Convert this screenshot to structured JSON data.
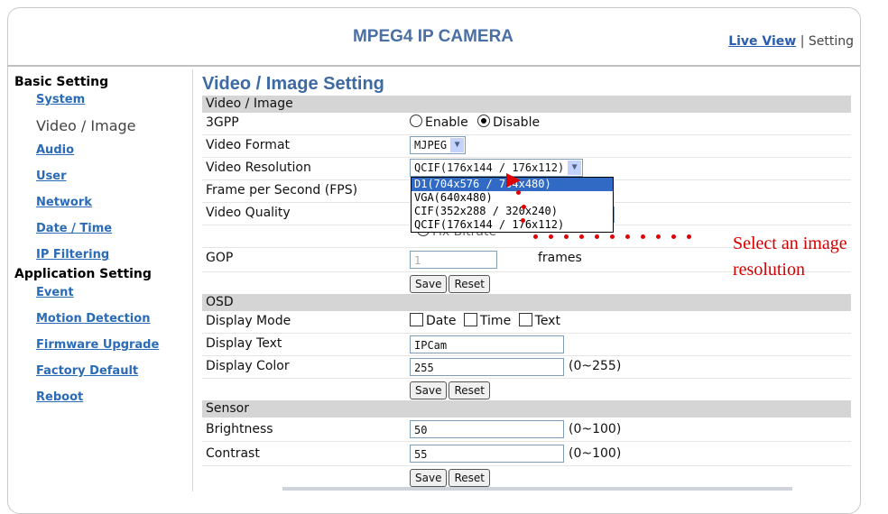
{
  "header": {
    "title": "MPEG4 IP CAMERA",
    "live_view": "Live View",
    "separator": "|",
    "setting": "Setting"
  },
  "sidebar": {
    "basic_label": "Basic Setting",
    "basic_items": [
      "System",
      "Video / Image",
      "Audio",
      "User",
      "Network",
      "Date / Time",
      "IP Filtering"
    ],
    "app_label": "Application Setting",
    "app_items": [
      "Event",
      "Motion Detection",
      "Firmware Upgrade",
      "Factory Default",
      "Reboot"
    ]
  },
  "main": {
    "page_title": "Video / Image Setting",
    "video_section": "Video / Image",
    "gpp_label": "3GPP",
    "enable": "Enable",
    "disable": "Disable",
    "format_label": "Video Format",
    "format_value": "MJPEG",
    "resolution_label": "Video Resolution",
    "resolution_value": "QCIF(176x144 / 176x112)",
    "fps_label": "Frame per Second (FPS)",
    "quality_label": "Video Quality",
    "fix_bitrate": "Fix Bitrate",
    "gop_label": "GOP",
    "gop_placeholder": "1",
    "gop_unit": "frames",
    "save": "Save",
    "reset": "Reset",
    "osd_section": "OSD",
    "display_mode_label": "Display Mode",
    "date": "Date",
    "time": "Time",
    "text": "Text",
    "display_text_label": "Display Text",
    "display_text_value": "IPCam",
    "display_color_label": "Display Color",
    "display_color_value": "255",
    "display_color_range": "(0~255)",
    "sensor_section": "Sensor",
    "brightness_label": "Brightness",
    "brightness_value": "50",
    "brightness_range": "(0~100)",
    "contrast_label": "Contrast",
    "contrast_value": "55",
    "contrast_range": "(0~100)"
  },
  "dropdown_options": [
    "D1(704x576 / 704x480)",
    "VGA(640x480)",
    "CIF(352x288 / 320x240)",
    "QCIF(176x144 / 176x112)"
  ],
  "annotation": {
    "line1": "Select an image",
    "line2": "resolution"
  },
  "colors": {
    "title": "#4a6fa5",
    "link": "#2a6bb8",
    "highlight": "#316ac5",
    "annotation": "#d40000",
    "section_bg": "#d5d5d5"
  }
}
